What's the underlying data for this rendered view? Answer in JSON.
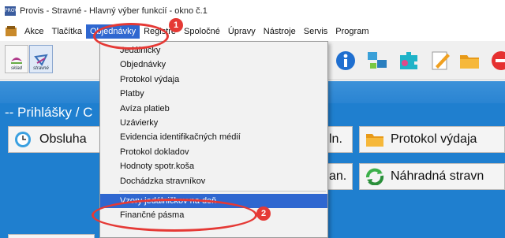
{
  "window": {
    "title": "Provis - Stravné - Hlavný výber funkcií - okno č.1",
    "app_icon_text": "PROVIS"
  },
  "menubar": {
    "items": [
      "Akce",
      "Tlačítka",
      "Objednávky",
      "Registre",
      "Spoločné",
      "Úpravy",
      "Nástroje",
      "Servis",
      "Program"
    ],
    "active": "Objednávky"
  },
  "toolbar": {
    "buttons": [
      {
        "label": "sklad",
        "icon": "sklad-icon"
      },
      {
        "label": "stravné",
        "icon": "stravne-icon"
      }
    ],
    "icons": [
      "info-icon",
      "network-icon",
      "puzzle-icon",
      "edit-icon",
      "folder-icon",
      "stop-icon"
    ]
  },
  "main": {
    "section_title": "-- Prihlášky / C",
    "tiles": [
      {
        "label": "Obsluha",
        "icon": "clock-icon"
      },
      {
        "label": "ln.",
        "icon": ""
      },
      {
        "label": "Protokol výdaja",
        "icon": "folder-icon"
      },
      {
        "label": "an.",
        "icon": ""
      },
      {
        "label": "Náhradná stravn",
        "icon": "recycle-icon"
      }
    ]
  },
  "dropdown": {
    "items": [
      "Jedálničky",
      "Objednávky",
      "Protokol výdaja",
      "Platby",
      "Avíza platieb",
      "Uzávierky",
      "Evidencia identifikačných médií",
      "Protokol dokladov",
      "Hodnoty spotr.koša",
      "Dochádzka stravníkov",
      "Vzory jedálničkov na deň",
      "Finančné pásma"
    ],
    "highlighted": "Vzory jedálničkov na deň"
  },
  "callouts": {
    "badge1": "1",
    "badge2": "2"
  },
  "colors": {
    "accent": "#2f67d0",
    "callout": "#e53935",
    "main_bg": "#1f7fcf"
  }
}
